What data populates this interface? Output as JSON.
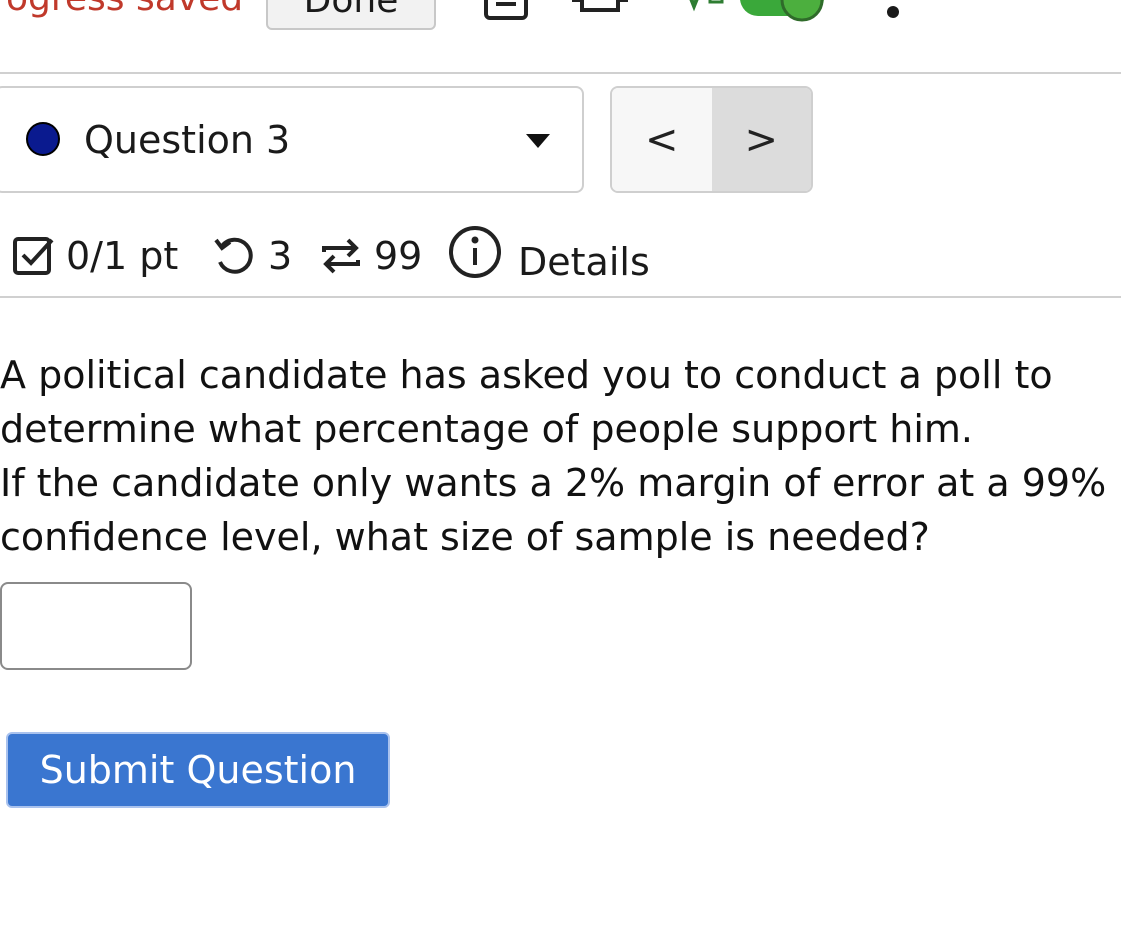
{
  "topbar": {
    "progress_text": "rogress saved",
    "done_label": "Done"
  },
  "question_nav": {
    "selected_label": "Question 3",
    "status_color": "#0a1a8f",
    "prev_label": "<",
    "next_label": ">"
  },
  "meta": {
    "score": "0/1 pt",
    "retries": "3",
    "attempts": "99",
    "details_label": "Details"
  },
  "question": {
    "line1": "A political candidate has asked you to conduct a poll to determine what percentage of people support him.",
    "line2": "If the candidate only wants a 2% margin of error at a 99% confidence level, what size of sample is needed?"
  },
  "answer": {
    "value": ""
  },
  "submit_label": "Submit Question",
  "colors": {
    "accent": "#3a76d0",
    "progress_text": "#c0392b",
    "toggle_on": "#3aa83a"
  }
}
